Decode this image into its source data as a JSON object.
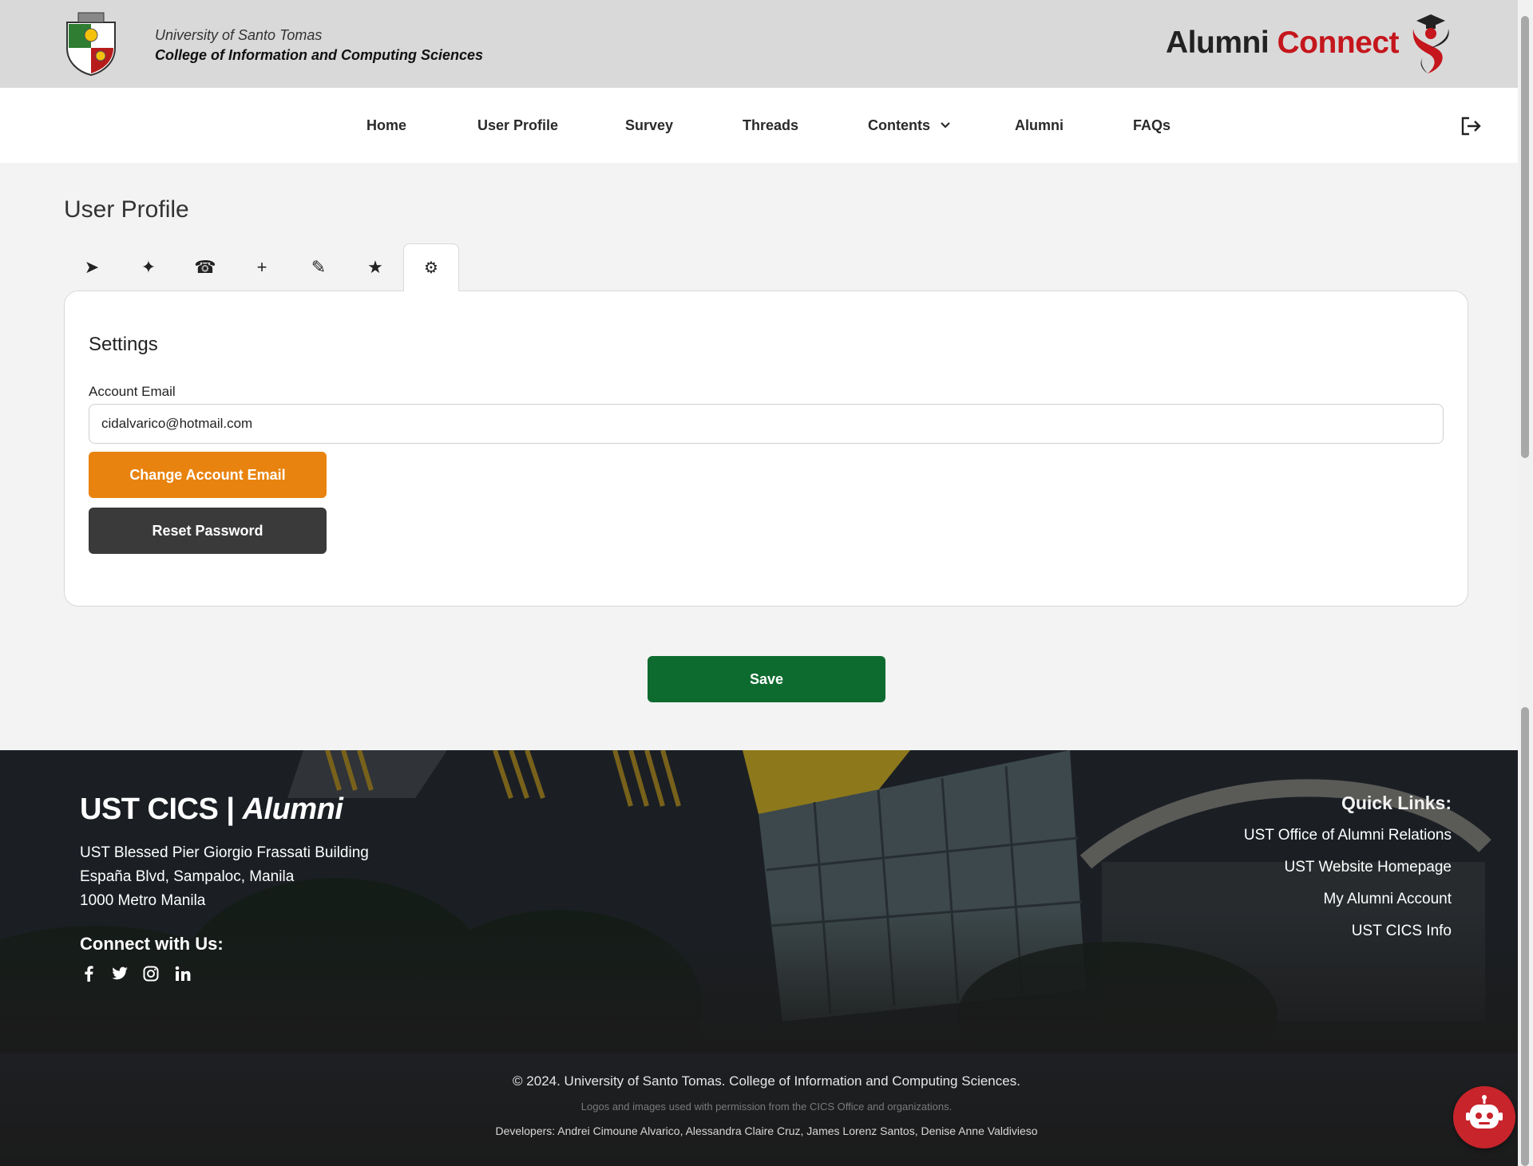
{
  "header": {
    "university": "University of Santo Tomas",
    "college": "College of Information and Computing Sciences",
    "brand_part1": "Alumni",
    "brand_part2": "Connect",
    "brand_accent_color": "#c4161c"
  },
  "nav": {
    "items": [
      {
        "label": "Home"
      },
      {
        "label": "User Profile"
      },
      {
        "label": "Survey"
      },
      {
        "label": "Threads"
      },
      {
        "label": "Contents"
      },
      {
        "label": "Alumni"
      },
      {
        "label": "FAQs"
      }
    ]
  },
  "main": {
    "title": "User Profile",
    "tabs": [
      {
        "icon": "send-icon",
        "glyph": "➤"
      },
      {
        "icon": "sparkle-icon",
        "glyph": "✦"
      },
      {
        "icon": "telephone-icon",
        "glyph": "☎"
      },
      {
        "icon": "plus-icon",
        "glyph": "+"
      },
      {
        "icon": "pencil-icon",
        "glyph": "✎"
      },
      {
        "icon": "star-icon",
        "glyph": "★"
      },
      {
        "icon": "gear-icon",
        "glyph": "⚙",
        "active": true
      }
    ],
    "settings": {
      "title": "Settings",
      "email_label": "Account Email",
      "email_value": "cidalvarico@hotmail.com",
      "change_email_label": "Change Account Email",
      "reset_password_label": "Reset Password"
    },
    "save_label": "Save"
  },
  "footer": {
    "title_main": "UST CICS |",
    "title_italic": "Alumni",
    "address": [
      "UST Blessed Pier Giorgio Frassati Building",
      "España Blvd, Sampaloc, Manila",
      "1000 Metro Manila"
    ],
    "connect_title": "Connect with Us:",
    "socials": [
      "facebook-icon",
      "twitter-icon",
      "instagram-icon",
      "linkedin-icon"
    ],
    "quick_links_title": "Quick Links:",
    "quick_links": [
      "UST Office of Alumni Relations",
      "UST Website Homepage",
      "My Alumni Account",
      "UST CICS Info"
    ],
    "copyright": "© 2024. University of Santo Tomas. College of Information and Computing Sciences.",
    "permission": "Logos and images used with permission from the CICS Office and organizations.",
    "developers": "Developers: Andrei Cimoune Alvarico, Alessandra Claire Cruz, James Lorenz Santos, Denise Anne Valdivieso"
  },
  "colors": {
    "change_email_button": "#e8830f",
    "reset_password_button": "#3a3a3a",
    "save_button": "#0d6b2f",
    "chatbot": "#c8242b"
  }
}
